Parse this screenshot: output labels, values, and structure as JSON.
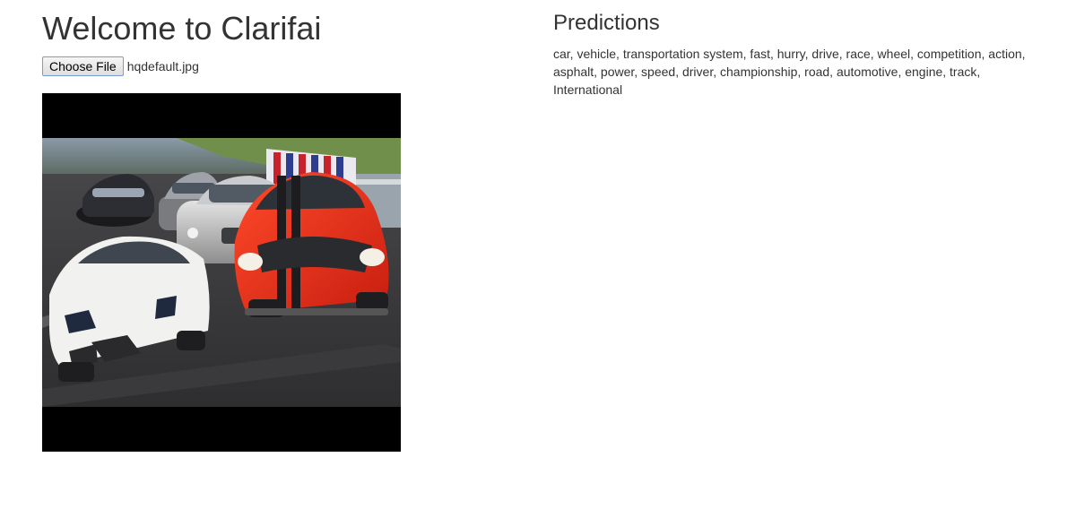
{
  "header": {
    "title": "Welcome to Clarifai"
  },
  "upload": {
    "choose_label": "Choose File",
    "file_name": "hqdefault.jpg"
  },
  "preview": {
    "icon": "race-cars-image"
  },
  "predictions": {
    "heading": "Predictions",
    "tags_text": "car, vehicle, transportation system, fast, hurry, drive, race, wheel, competition, action, asphalt, power, speed, driver, championship, road, automotive, engine, track, International"
  }
}
